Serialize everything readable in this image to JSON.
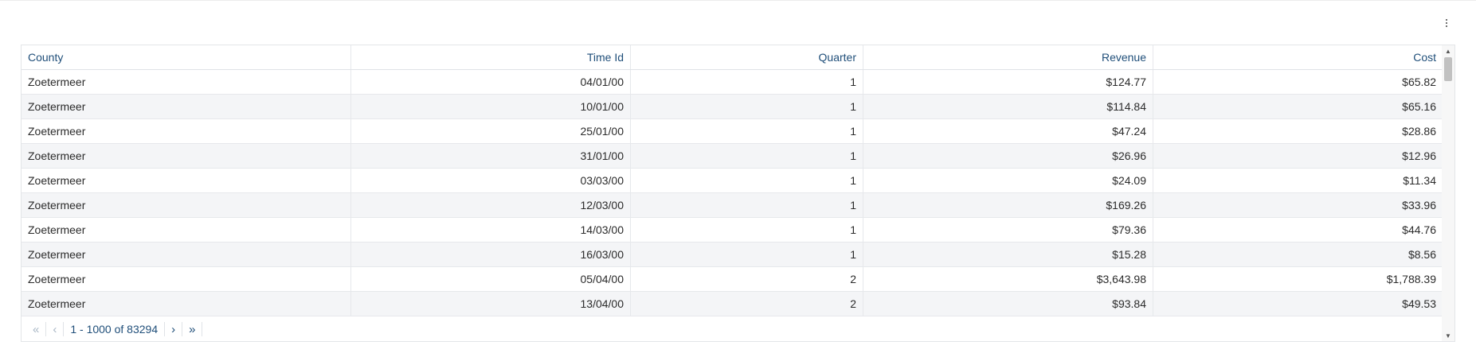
{
  "menu": {
    "icon": "more-vertical-icon"
  },
  "table": {
    "columns": [
      "County",
      "Time Id",
      "Quarter",
      "Revenue",
      "Cost"
    ],
    "rows": [
      [
        "Zoetermeer",
        "04/01/00",
        "1",
        "$124.77",
        "$65.82"
      ],
      [
        "Zoetermeer",
        "10/01/00",
        "1",
        "$114.84",
        "$65.16"
      ],
      [
        "Zoetermeer",
        "25/01/00",
        "1",
        "$47.24",
        "$28.86"
      ],
      [
        "Zoetermeer",
        "31/01/00",
        "1",
        "$26.96",
        "$12.96"
      ],
      [
        "Zoetermeer",
        "03/03/00",
        "1",
        "$24.09",
        "$11.34"
      ],
      [
        "Zoetermeer",
        "12/03/00",
        "1",
        "$169.26",
        "$33.96"
      ],
      [
        "Zoetermeer",
        "14/03/00",
        "1",
        "$79.36",
        "$44.76"
      ],
      [
        "Zoetermeer",
        "16/03/00",
        "1",
        "$15.28",
        "$8.56"
      ],
      [
        "Zoetermeer",
        "05/04/00",
        "2",
        "$3,643.98",
        "$1,788.39"
      ],
      [
        "Zoetermeer",
        "13/04/00",
        "2",
        "$93.84",
        "$49.53"
      ]
    ]
  },
  "pagination": {
    "first": "«",
    "prev": "‹",
    "range": "1 - 1000 of 83294",
    "next": "›",
    "last": "»"
  },
  "colors": {
    "header_text": "#1f4e79",
    "stripe": "#f4f5f7"
  }
}
